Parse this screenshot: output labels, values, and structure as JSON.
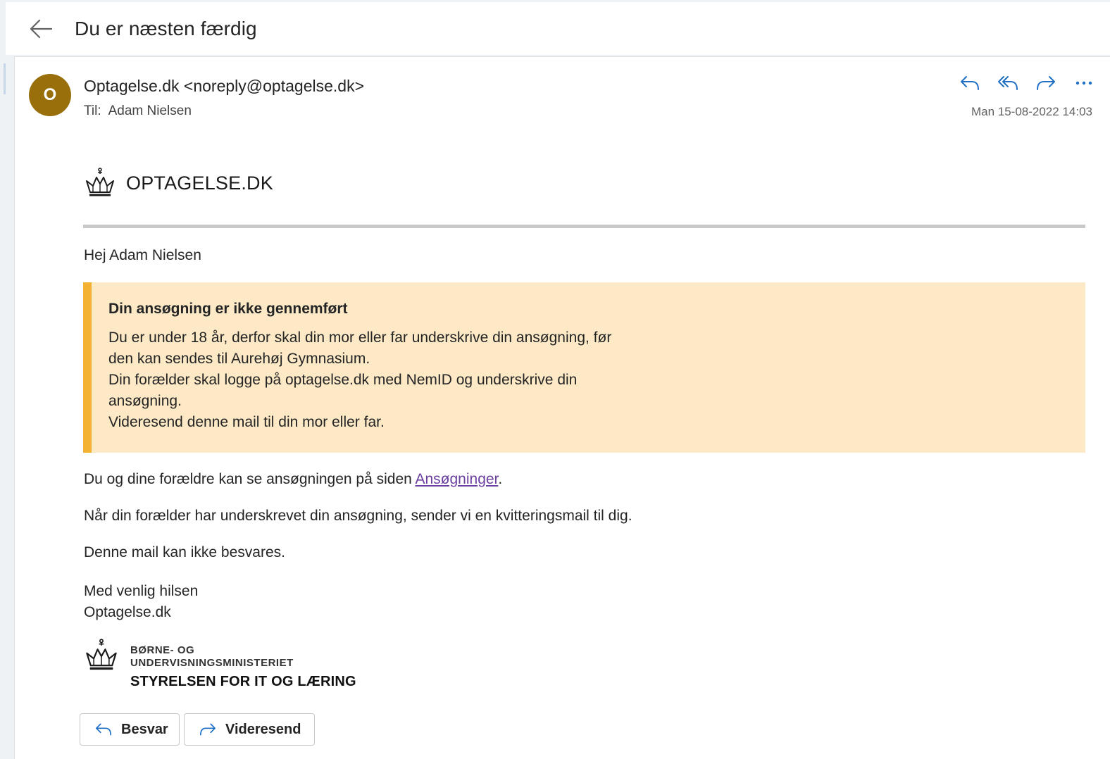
{
  "header": {
    "subject": "Du er næsten færdig"
  },
  "message": {
    "avatar_initial": "O",
    "avatar_color": "#986f0b",
    "sender": "Optagelse.dk <noreply@optagelse.dk>",
    "to_label": "Til:",
    "to_name": "Adam Nielsen",
    "date": "Man 15-08-2022 14:03",
    "actions": [
      "reply-icon",
      "reply-all-icon",
      "forward-icon",
      "more-icon"
    ]
  },
  "body": {
    "logo_text": "OPTAGELSE.DK",
    "greeting": "Hej Adam Nielsen",
    "notice": {
      "title": "Din ansøgning er ikke gennemført",
      "lines": [
        "Du er under 18 år, derfor skal din mor eller far underskrive din ansøgning, før",
        "den kan sendes til Aurehøj Gymnasium.",
        "Din forælder skal logge på optagelse.dk med NemID og underskrive din",
        "ansøgning.",
        "Videresend denne mail til din mor eller far."
      ],
      "bg_color": "#fde9c6",
      "accent_color": "#f4b233"
    },
    "para1_before": "Du og dine forældre kan se ansøgningen på siden ",
    "para1_link": "Ansøgninger",
    "para1_after": ".",
    "para2": "Når din forælder har underskrevet din ansøgning, sender vi en kvitteringsmail til dig.",
    "para3": "Denne mail kan ikke besvares.",
    "closing_line1": "Med venlig hilsen",
    "closing_line2": "Optagelse.dk",
    "footer_line1": "BØRNE- OG",
    "footer_line2": "UNDERVISNINGSMINISTERIET",
    "footer_line3": "STYRELSEN FOR IT OG LÆRING"
  },
  "buttons": {
    "reply": "Besvar",
    "forward": "Videresend"
  }
}
